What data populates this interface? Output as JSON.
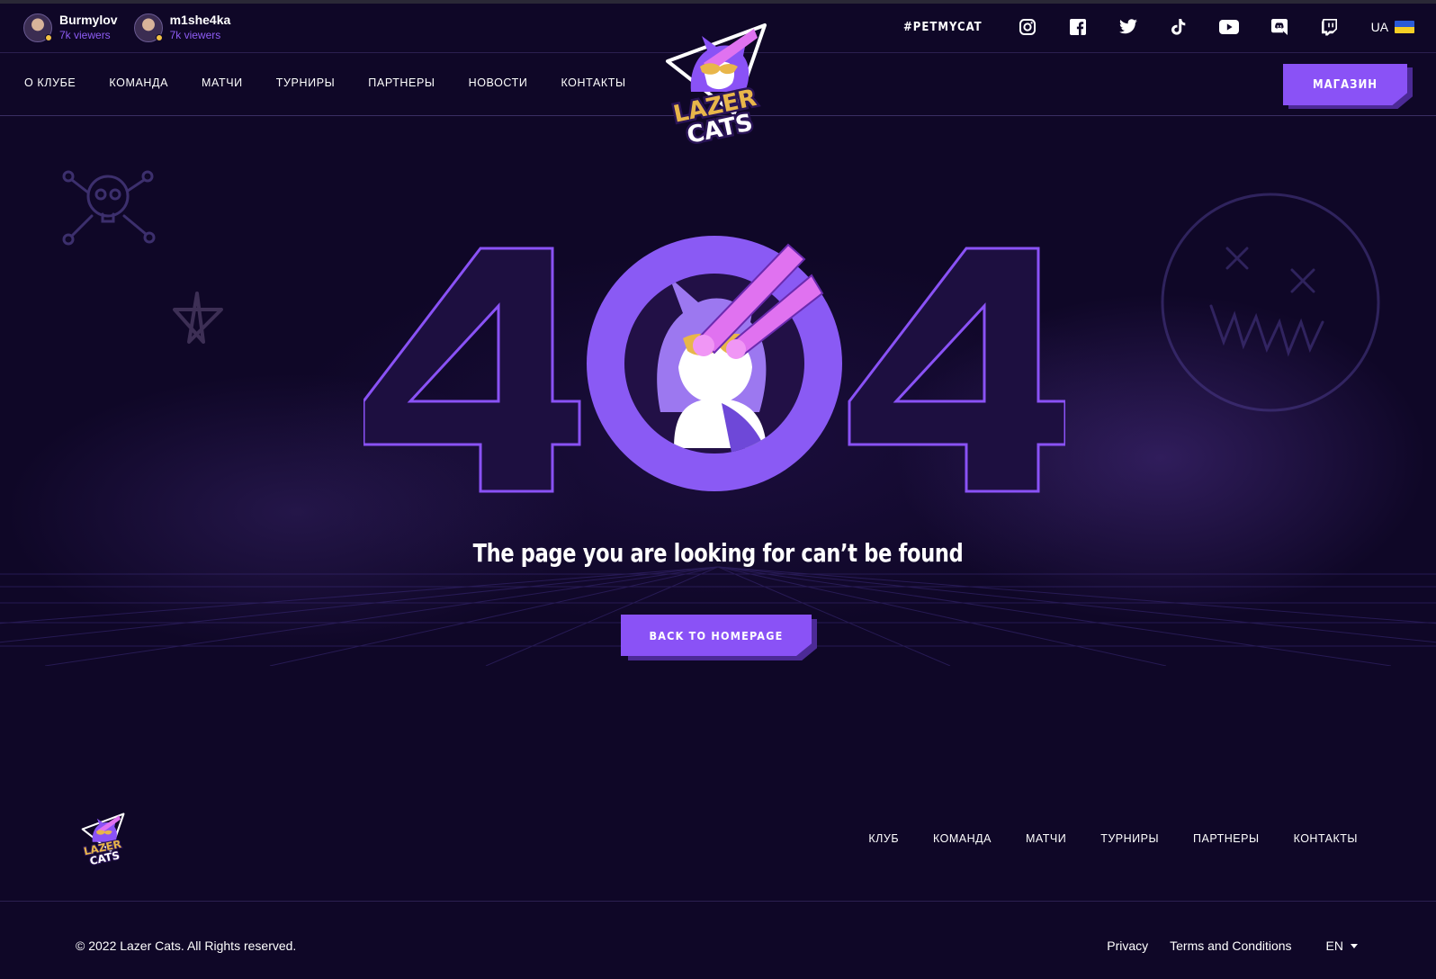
{
  "streamers": [
    {
      "name": "Burmylov",
      "viewers": "7k viewers"
    },
    {
      "name": "m1she4ka",
      "viewers": "7k viewers"
    }
  ],
  "social": {
    "hashtag": "#PETMYCAT",
    "icons": [
      "instagram-icon",
      "facebook-icon",
      "twitter-icon",
      "tiktok-icon",
      "youtube-icon",
      "discord-icon",
      "twitch-icon"
    ],
    "language": "UA",
    "flag_colors": [
      "#2a5bd7",
      "#f5cf25"
    ]
  },
  "nav": {
    "items": [
      "О КЛУБЕ",
      "КОМАНДА",
      "МАТЧИ",
      "ТУРНИРЫ",
      "ПАРТНЕРЫ",
      "НОВОСТИ",
      "КОНТАКТЫ"
    ],
    "shop_label": "МАГАЗИН"
  },
  "hero": {
    "code_left": "4",
    "code_right": "4",
    "message": "The page you are looking for can’t be found",
    "back_label": "BACK TO HOMEPAGE"
  },
  "footer": {
    "nav": [
      "КЛУБ",
      "КОМАНДА",
      "МАТЧИ",
      "ТУРНИРЫ",
      "ПАРТНЕРЫ",
      "КОНТАКТЫ"
    ],
    "copyright": "© 2022 Lazer Cats. All Rights reserved.",
    "links": [
      "Privacy",
      "Terms and Conditions"
    ],
    "language": "EN"
  },
  "colors": {
    "background": "#0f0727",
    "accent": "#8a52f6",
    "accent_dark": "#4c2a96",
    "laser": "#e072f0",
    "gold": "#e8b64a",
    "viewers": "#8e5cf4"
  }
}
